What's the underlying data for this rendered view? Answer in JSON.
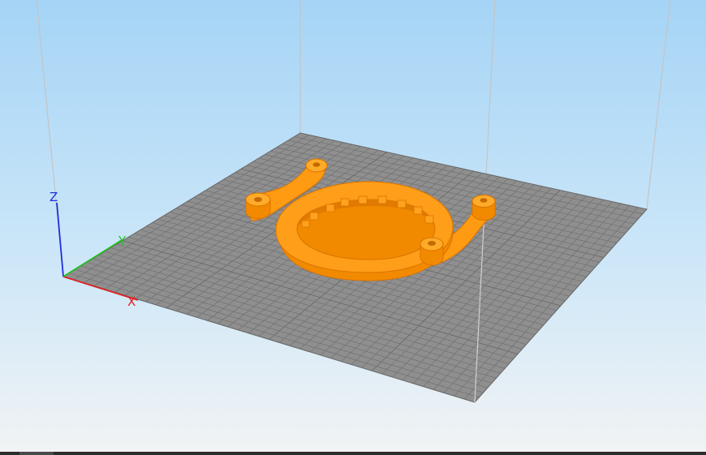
{
  "viewport": {
    "axis_labels": {
      "x": "X",
      "y": "Y",
      "z": "Z"
    },
    "colors": {
      "sky_top": "#a9d6f5",
      "sky_bottom": "#eef3f6",
      "bed": "#8c8c8c",
      "grid_line": "#6f6f6f",
      "model": "#ff9a0f",
      "model_shade": "#e37c00",
      "axis_x": "#e02020",
      "axis_y": "#22c022",
      "axis_z": "#2030e0",
      "build_volume_edge": "#c8c8c8"
    },
    "objects": [
      "build-plate",
      "build-volume-frame",
      "printed-model-ring-bracket",
      "axis-gizmo"
    ]
  }
}
